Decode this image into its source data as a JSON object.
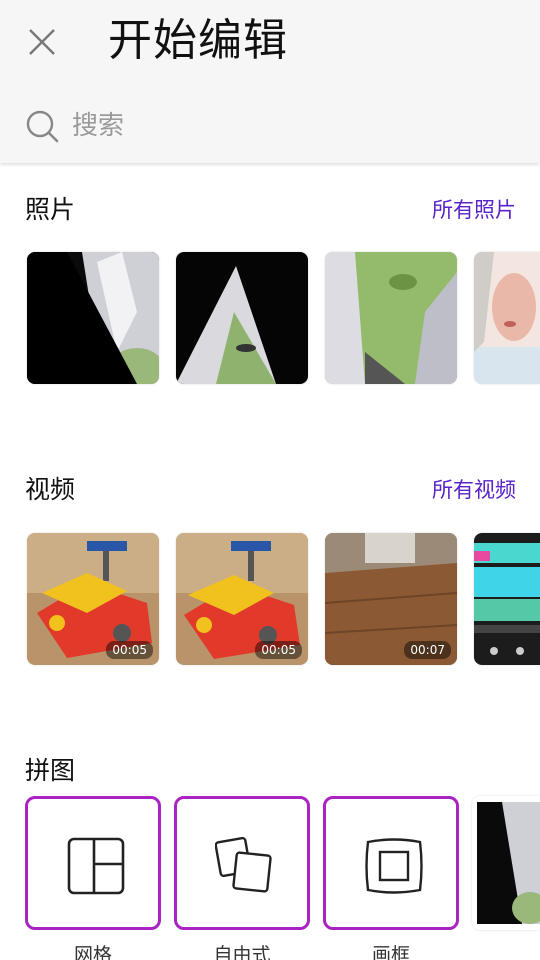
{
  "header": {
    "title": "开始编辑",
    "close_icon": "close-icon",
    "search_placeholder": "搜索"
  },
  "photos": {
    "title": "照片",
    "link": "所有照片",
    "items": [
      {
        "desc": "photo-1"
      },
      {
        "desc": "photo-2"
      },
      {
        "desc": "photo-3"
      },
      {
        "desc": "photo-4"
      }
    ]
  },
  "videos": {
    "title": "视频",
    "link": "所有视频",
    "items": [
      {
        "duration": "00:05"
      },
      {
        "duration": "00:05"
      },
      {
        "duration": "00:07"
      },
      {
        "duration": ""
      }
    ]
  },
  "collage": {
    "title": "拼图",
    "items": [
      {
        "label": "网格",
        "icon": "grid-icon"
      },
      {
        "label": "自由式",
        "icon": "freestyle-icon"
      },
      {
        "label": "画框",
        "icon": "frame-icon"
      }
    ]
  },
  "colors": {
    "accent": "#5a22c9",
    "collage_border": "#a922c2"
  }
}
